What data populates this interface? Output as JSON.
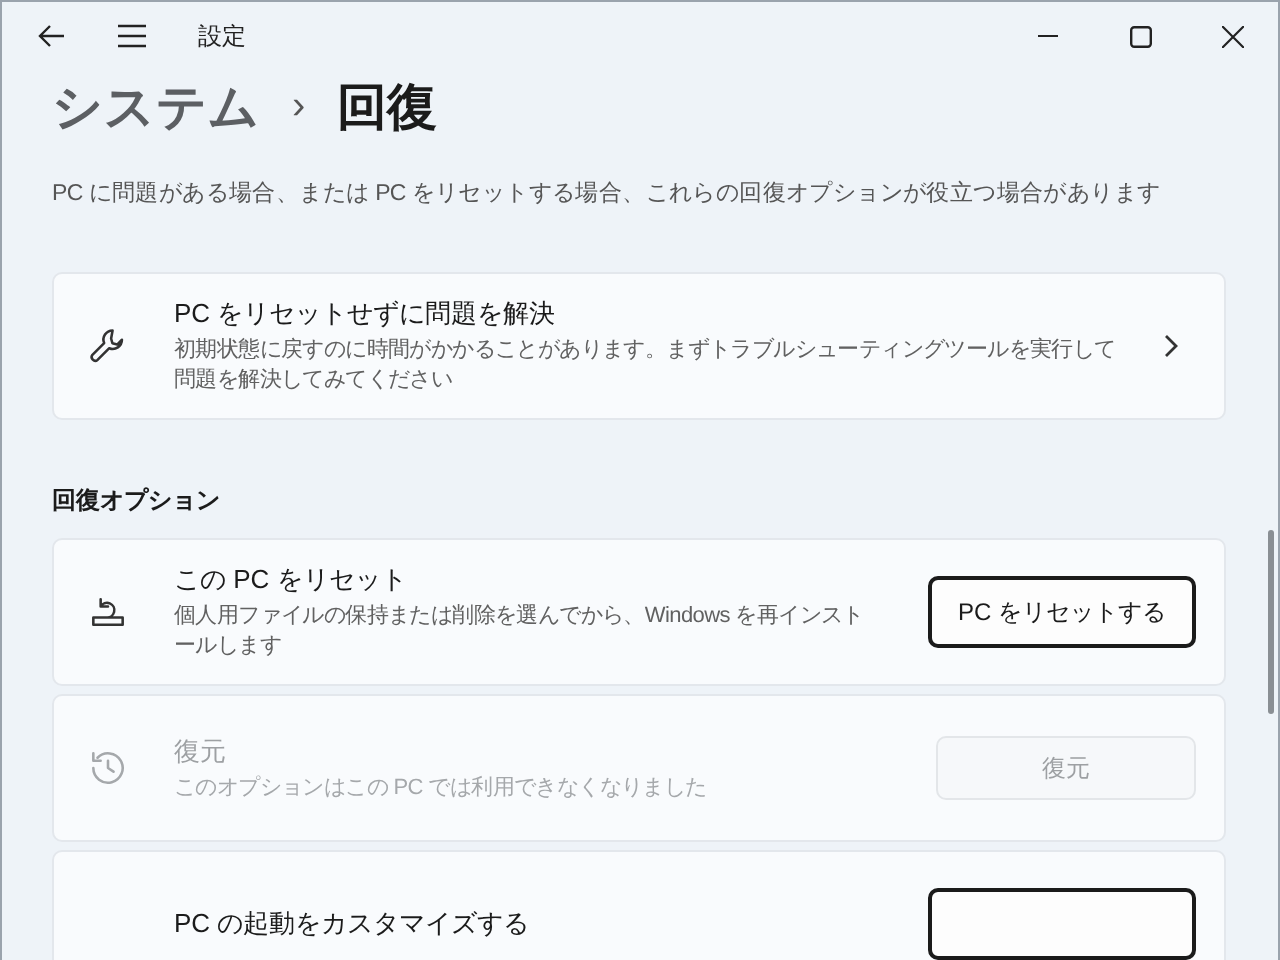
{
  "window": {
    "title": "設定"
  },
  "breadcrumb": {
    "parent": "システム",
    "separator": "›",
    "current": "回復"
  },
  "description": "PC に問題がある場合、または PC をリセットする場合、これらの回復オプションが役立つ場合があります",
  "troubleshoot": {
    "kind": "link",
    "title": "PC をリセットせずに問題を解決",
    "subtitle": "初期状態に戻すのに時間がかかることがあります。まずトラブルシューティングツールを実行して問題を解決してみてください",
    "disabled": false
  },
  "section": {
    "heading": "回復オプション",
    "items": [
      {
        "kind": "action",
        "title": "この PC をリセット",
        "subtitle": "個人用ファイルの保持または削除を選んでから、Windows を再インストールします",
        "button": "PC をリセットする",
        "disabled": false
      },
      {
        "kind": "action",
        "title": "復元",
        "subtitle": "このオプションはこの PC では利用できなくなりました",
        "button": "復元",
        "disabled": true
      },
      {
        "kind": "action",
        "title": "PC の起動をカスタマイズする",
        "disabled": false
      }
    ]
  }
}
